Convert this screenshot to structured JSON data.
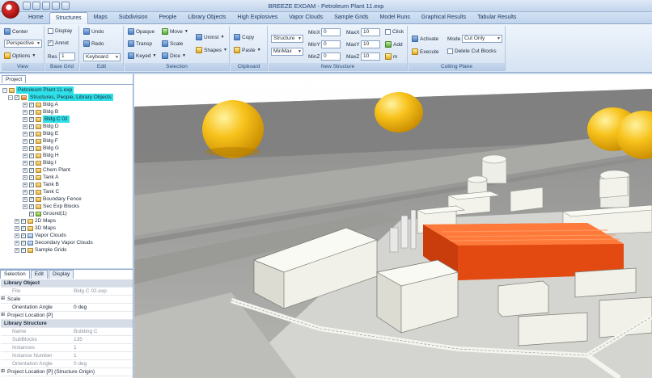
{
  "window": {
    "title": "BREEZE EXDAM - Petroleum Plant 11.exp"
  },
  "tabs": [
    "Home",
    "Structures",
    "Maps",
    "Subdivision",
    "People",
    "Library Objects",
    "High Explosives",
    "Vapor Clouds",
    "Sample Grids",
    "Model Runs",
    "Graphical Results",
    "Tabular Results"
  ],
  "active_tab": "Structures",
  "ribbon": {
    "view": {
      "center_label": "Center",
      "camera_value": "Perspective",
      "options_label": "Options",
      "group_label": "View"
    },
    "base_grid": {
      "display_label": "Display",
      "annot_label": "Annot",
      "res_label": "Res",
      "res_value": "1",
      "group_label": "Base Grid"
    },
    "edit": {
      "undo_label": "Undo",
      "redo_label": "Redo",
      "mode_value": "Keyboard",
      "group_label": "Edit"
    },
    "selection": {
      "opaque_label": "Opaque",
      "transp_label": "Transp",
      "keyed_label": "Keyed",
      "move_label": "Move",
      "scale_label": "Scale",
      "dice_label": "Dice",
      "uninst_label": "Uninst",
      "shapes_label": "Shapes",
      "group_label": "Selection"
    },
    "clipboard": {
      "copy_label": "Copy",
      "paste_label": "Paste",
      "group_label": "Clipboard"
    },
    "new_structure": {
      "type_value": "Structure",
      "mode_value": "MinMax",
      "minx_label": "MinX",
      "minx_value": "0",
      "miny_label": "MinY",
      "miny_value": "0",
      "minz_label": "MinZ",
      "minz_value": "0",
      "maxx_label": "MaxX",
      "maxx_value": "10",
      "maxy_label": "MaxY",
      "maxy_value": "10",
      "maxz_label": "MaxZ",
      "maxz_value": "10",
      "click_label": "Click",
      "add_label": "Add",
      "m_label": "m",
      "group_label": "New Structure"
    },
    "cut_plane": {
      "activate_label": "Activate",
      "execute_label": "Execute",
      "mode_label": "Mode",
      "mode_value": "Cut Only",
      "delete_label": "Delete Cut Blocks",
      "group_label": "Cutting Plane"
    }
  },
  "project": {
    "tab_label": "Project",
    "root": "Petroleum Plant 11.exp",
    "folder": "Structures, People, Library Objects",
    "items": [
      "Bldg A",
      "Bldg B",
      "Bldg C 02",
      "Bldg D",
      "Bldg E",
      "Bldg F",
      "Bldg G",
      "Bldg H",
      "Bldg I",
      "Chem Plant",
      "Tank A",
      "Tank B",
      "Tank C",
      "Boundary Fence",
      "Sec Exp Blocks",
      "Ground(1)"
    ],
    "other": [
      "2D Maps",
      "3D Maps",
      "Vapor Clouds",
      "Secondary Vapor Clouds",
      "Sample Grids"
    ]
  },
  "selection_panel": {
    "tabs": [
      "Selection",
      "Edit",
      "Display"
    ],
    "rows": [
      {
        "type": "section",
        "k": "Library Object"
      },
      {
        "type": "row",
        "k": "File",
        "v": "Bldg C 02.exp",
        "muted": true
      },
      {
        "type": "row",
        "k": "Scale",
        "v": "",
        "muted": false,
        "expand": true
      },
      {
        "type": "row",
        "k": "Orientation Angle",
        "v": "0 deg",
        "muted": false
      },
      {
        "type": "row",
        "k": "Project Location [P]",
        "v": "",
        "muted": false,
        "expand": true
      },
      {
        "type": "section",
        "k": "Library Structure"
      },
      {
        "type": "row",
        "k": "Name",
        "v": "Building C",
        "muted": true
      },
      {
        "type": "row",
        "k": "SubBlocks",
        "v": "135",
        "muted": true
      },
      {
        "type": "row",
        "k": "Instances",
        "v": "1",
        "muted": true
      },
      {
        "type": "row",
        "k": "Instance Number",
        "v": "1",
        "muted": true
      },
      {
        "type": "row",
        "k": "Orientation Angle",
        "v": "0 deg",
        "muted": true
      },
      {
        "type": "row",
        "k": "Project Location [P] (Structure Origin)",
        "v": "",
        "muted": false,
        "expand": true
      }
    ]
  },
  "colors": {
    "selected_building": "#f05a1e",
    "sphere": "#f7c21b",
    "highlight": "#30e0e8"
  }
}
